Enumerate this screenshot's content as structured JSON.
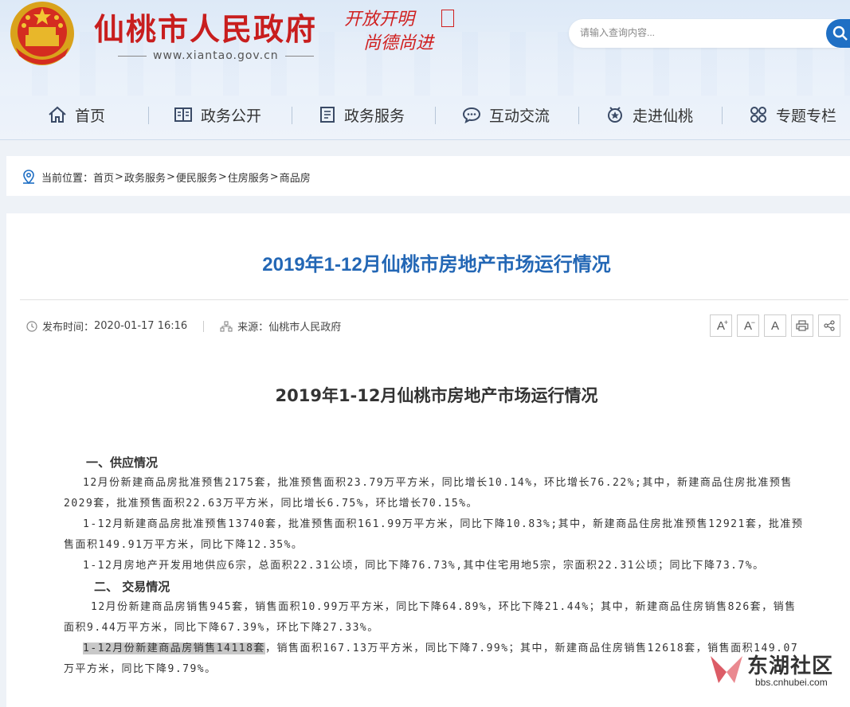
{
  "header": {
    "site_title": "仙桃市人民政府",
    "site_url": "www.xiantao.gov.cn",
    "slogan_line1": "开放开明",
    "slogan_line2": "尚德尚进",
    "search_placeholder": "请输入查询内容..."
  },
  "nav": [
    {
      "label": "首页",
      "icon": "home-icon"
    },
    {
      "label": "政务公开",
      "icon": "book-icon"
    },
    {
      "label": "政务服务",
      "icon": "document-icon"
    },
    {
      "label": "互动交流",
      "icon": "chat-icon"
    },
    {
      "label": "走进仙桃",
      "icon": "badge-icon"
    },
    {
      "label": "专题专栏",
      "icon": "grid-icon"
    }
  ],
  "breadcrumb": {
    "prefix": "当前位置：",
    "items": [
      "首页",
      "政务服务",
      "便民服务",
      "住房服务",
      "商品房"
    ],
    "separator": ">"
  },
  "article": {
    "title": "2019年1-12月仙桃市房地产市场运行情况",
    "publish_label": "发布时间：",
    "publish_time": "2020-01-17 16:16",
    "source_label": "来源：",
    "source": "仙桃市人民政府",
    "tools": [
      "A+",
      "A-",
      "A",
      "print-icon",
      "share-icon"
    ],
    "content_title": "2019年1-12月仙桃市房地产市场运行情况",
    "sections": {
      "s1_heading": "一、供应情况",
      "p1": "12月份新建商品房批准预售2175套，批准预售面积23.79万平方米，同比增长10.14%，环比增长76.22%;其中，新建商品住房批准预售2029套，批准预售面积22.63万平方米，同比增长6.75%，环比增长70.15%。",
      "p2": "1-12月新建商品房批准预售13740套，批准预售面积161.99万平方米，同比下降10.83%;其中，新建商品住房批准预售12921套，批准预售面积149.91万平方米，同比下降12.35%。",
      "p3": "1-12月房地产开发用地供应6宗，总面积22.31公顷，同比下降76.73%,其中住宅用地5宗，宗面积22.31公顷；同比下降73.7%。",
      "s2_heading": "二、  交易情况",
      "p4": "12月份新建商品房销售945套，销售面积10.99万平方米，同比下降64.89%，环比下降21.44%；其中，新建商品住房销售826套，销售面积9.44万平方米，同比下降67.39%，环比下降27.33%。",
      "p5_highlight": "1-12月份新建商品房销售14118套",
      "p5_rest": "，销售面积167.13万平方米，同比下降7.99%；其中，新建商品住房销售12618套，销售面积149.07万平方米，同比下降9.79%。"
    }
  },
  "watermark": {
    "name": "东湖社区",
    "url": "bbs.cnhubei.com"
  }
}
